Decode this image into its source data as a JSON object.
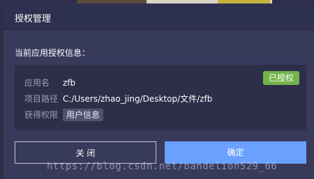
{
  "dialog": {
    "title": "授权管理",
    "section_label": "当前应用授权信息："
  },
  "info": {
    "app_name_label": "应用名",
    "app_name_value": "zfb",
    "path_label": "项目路径",
    "path_value": "C:/Users/zhao_jing/Desktop/文件/zfb",
    "perm_label": "获得权限",
    "perm_tags": [
      "用户信息"
    ],
    "status_badge": "已授权"
  },
  "buttons": {
    "close_label": "关 闭",
    "ok_label": "确定"
  },
  "watermark": "https://blog.csdn.net/bandelion529_66",
  "colors": {
    "dialog_bg": "#383a5c",
    "titlebar_bg": "#2e3050",
    "panel_bg": "#2c2e4a",
    "granted_badge": "#72b34a",
    "primary_button": "#6aa1ff"
  }
}
